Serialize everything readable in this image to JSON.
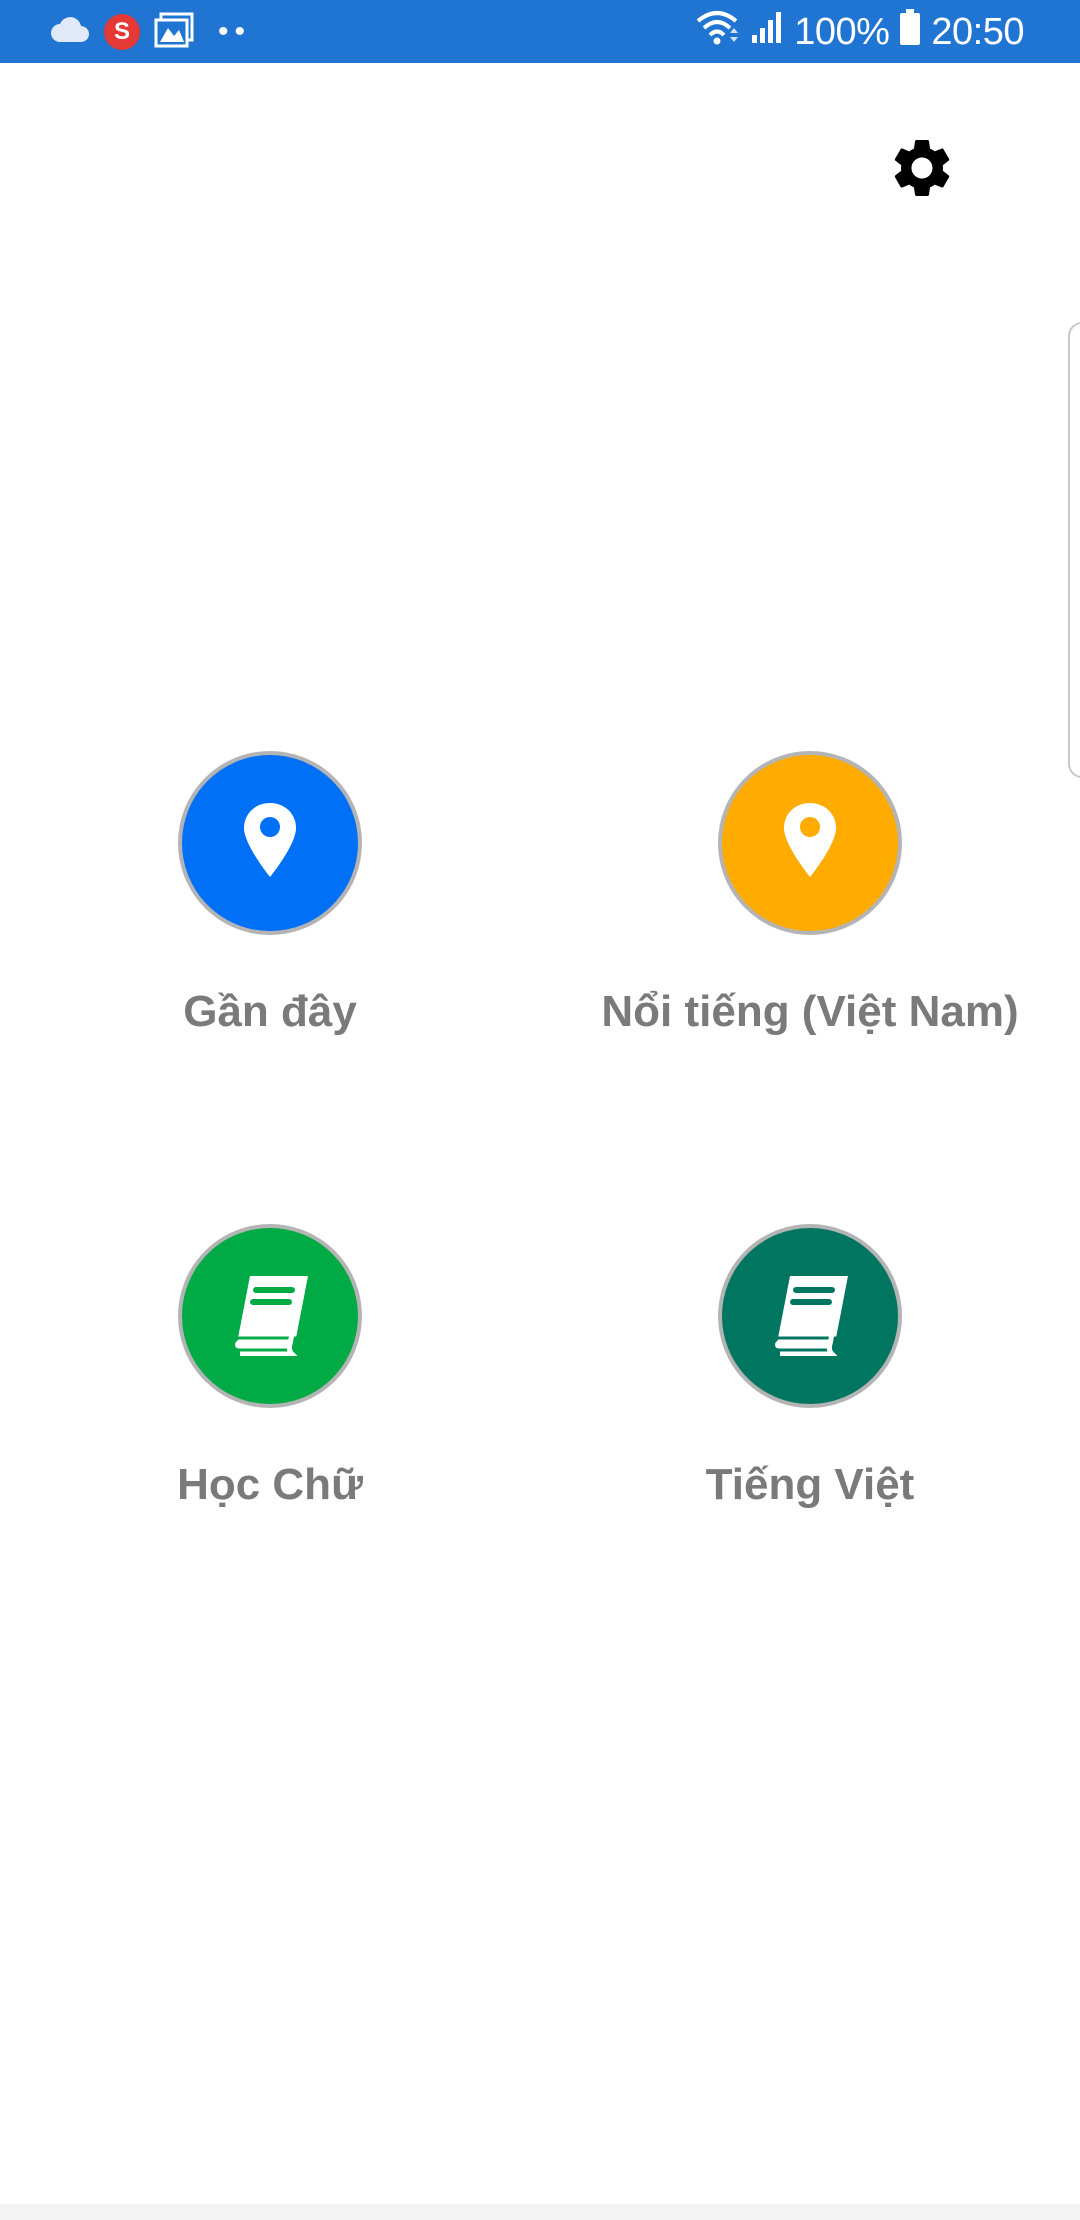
{
  "status_bar": {
    "battery": "100%",
    "time": "20:50",
    "s_badge": "S",
    "icons": [
      "cloud-icon",
      "s-app-icon",
      "gallery-icon",
      "more-dots-icon",
      "wifi-icon",
      "signal-icon",
      "battery-icon"
    ]
  },
  "header": {
    "settings_icon": "gear-icon"
  },
  "menu": {
    "items": [
      {
        "label": "Gần đây",
        "icon": "map-pin-icon",
        "color": "#0070f6"
      },
      {
        "label": "Nổi tiếng (Việt Nam)",
        "icon": "map-pin-icon",
        "color": "#ffab00"
      },
      {
        "label": "Học Chữ",
        "icon": "book-icon",
        "color": "#00ab45"
      },
      {
        "label": "Tiếng Việt",
        "icon": "book-icon",
        "color": "#007660"
      }
    ]
  }
}
